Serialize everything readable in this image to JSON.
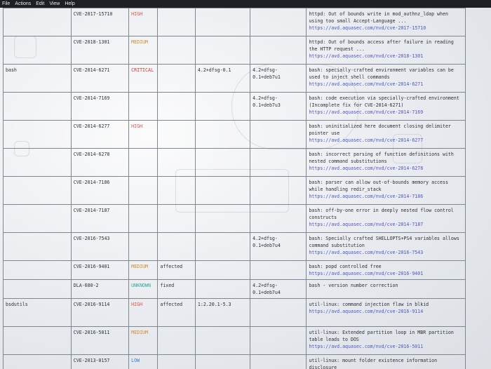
{
  "menu": [
    "File",
    "Actions",
    "Edit",
    "View",
    "Help"
  ],
  "rows": [
    {
      "library": "",
      "id": "CVE-2017-15710",
      "severity": "HIGH",
      "status": "",
      "installed": "",
      "fixed": "",
      "title": "httpd: Out of bounds write in mod_authnz_ldap when using too small Accept-Language ...",
      "url": "https://avd.aquasec.com/nvd/cve-2017-15710"
    },
    {
      "library": "",
      "id": "CVE-2018-1301",
      "severity": "MEDIUM",
      "status": "",
      "installed": "",
      "fixed": "",
      "title": "httpd: Out of bounds access after failure in reading the HTTP request ...",
      "url": "https://avd.aquasec.com/nvd/cve-2018-1301"
    },
    {
      "library": "bash",
      "id": "CVE-2014-6271",
      "severity": "CRITICAL",
      "status": "",
      "installed": "4.2+dfsg-0.1",
      "fixed": "4.2+dfsg-0.1+deb7u1",
      "title": "bash: specially-crafted environment variables can be used to inject shell commands",
      "url": "https://avd.aquasec.com/nvd/cve-2014-6271"
    },
    {
      "library": "",
      "id": "CVE-2014-7169",
      "severity": "",
      "status": "",
      "installed": "",
      "fixed": "4.2+dfsg-0.1+deb7u3",
      "title": "bash: code execution via specially-crafted environment (Incomplete fix for CVE-2014-6271)",
      "url": "https://avd.aquasec.com/nvd/cve-2014-7169"
    },
    {
      "library": "",
      "id": "CVE-2014-6277",
      "severity": "HIGH",
      "status": "",
      "installed": "",
      "fixed": "",
      "title": "bash: uninitialized here document closing delimiter pointer use",
      "url": "https://avd.aquasec.com/nvd/cve-2014-6277"
    },
    {
      "library": "",
      "id": "CVE-2014-6278",
      "severity": "",
      "status": "",
      "installed": "",
      "fixed": "",
      "title": "bash: incorrect parsing of function definitions with nested command substitutions",
      "url": "https://avd.aquasec.com/nvd/cve-2014-6278"
    },
    {
      "library": "",
      "id": "CVE-2014-7186",
      "severity": "",
      "status": "",
      "installed": "",
      "fixed": "",
      "title": "bash: parser can allow out-of-bounds memory access while handling redir_stack",
      "url": "https://avd.aquasec.com/nvd/cve-2014-7186"
    },
    {
      "library": "",
      "id": "CVE-2014-7187",
      "severity": "",
      "status": "",
      "installed": "",
      "fixed": "",
      "title": "bash: off-by-one error in deeply nested flow control constructs",
      "url": "https://avd.aquasec.com/nvd/cve-2014-7187"
    },
    {
      "library": "",
      "id": "CVE-2016-7543",
      "severity": "",
      "status": "",
      "installed": "",
      "fixed": "4.2+dfsg-0.1+deb7u4",
      "title": "bash: Specially crafted SHELLOPTS+PS4 variables allows command substitution",
      "url": "https://avd.aquasec.com/nvd/cve-2016-7543"
    },
    {
      "library": "",
      "id": "CVE-2016-9401",
      "severity": "MEDIUM",
      "status": "affected",
      "installed": "",
      "fixed": "",
      "title": "bash: popd controlled free",
      "url": "https://avd.aquasec.com/nvd/cve-2016-9401"
    },
    {
      "library": "",
      "id": "DLA-680-2",
      "severity": "UNKNOWN",
      "status": "fixed",
      "installed": "",
      "fixed": "4.2+dfsg-0.1+deb7u4",
      "title": "bash - version number correction",
      "url": ""
    },
    {
      "library": "bsdutils",
      "id": "CVE-2016-9114",
      "severity": "HIGH",
      "status": "affected",
      "installed": "1:2.20.1-5.3",
      "fixed": "",
      "title": "util-linux: command injection flaw in blkid",
      "url": "https://avd.aquasec.com/nvd/cve-2016-9114"
    },
    {
      "library": "",
      "id": "CVE-2016-5011",
      "severity": "MEDIUM",
      "status": "",
      "installed": "",
      "fixed": "",
      "title": "util-linux: Extended partition loop in MBR partition table leads to DOS",
      "url": "https://avd.aquasec.com/nvd/cve-2016-5011"
    },
    {
      "library": "",
      "id": "CVE-2013-0157",
      "severity": "LOW",
      "status": "",
      "installed": "",
      "fixed": "",
      "title": "util-linux: mount folder existence information disclosure",
      "url": ""
    }
  ]
}
